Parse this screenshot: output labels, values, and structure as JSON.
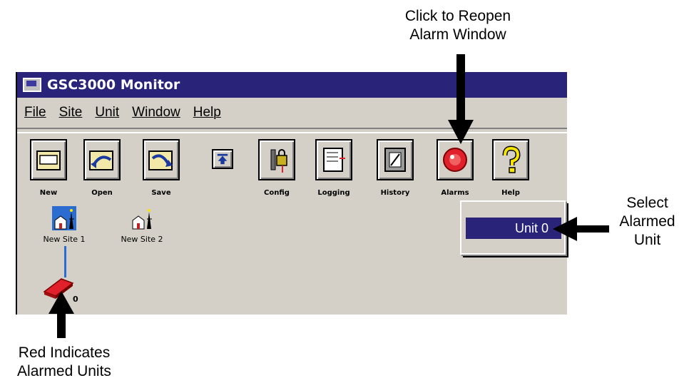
{
  "window": {
    "title": "GSC3000 Monitor"
  },
  "menu": [
    "File",
    "Site",
    "Unit",
    "Window",
    "Help"
  ],
  "toolbar": {
    "new": "New",
    "open": "Open",
    "save": "Save",
    "config": "Config",
    "logging": "Logging",
    "history": "History",
    "alarms": "Alarms",
    "help": "Help"
  },
  "sites": [
    {
      "label": "New Site 1"
    },
    {
      "label": "New Site 2"
    }
  ],
  "unit_node": {
    "label": "Unit 0",
    "visible_label": "0"
  },
  "alarm_list": {
    "items": [
      "Unit 0"
    ]
  },
  "callouts": {
    "reopen": "Click to Reopen\nAlarm Window",
    "select": "Select\nAlarmed\nUnit",
    "red": "Red Indicates\nAlarmed Units"
  },
  "colors": {
    "titlebar": "#29237a",
    "window_bg": "#d4d0c8",
    "alarm_red": "#e0202a",
    "selection": "#29237a"
  }
}
